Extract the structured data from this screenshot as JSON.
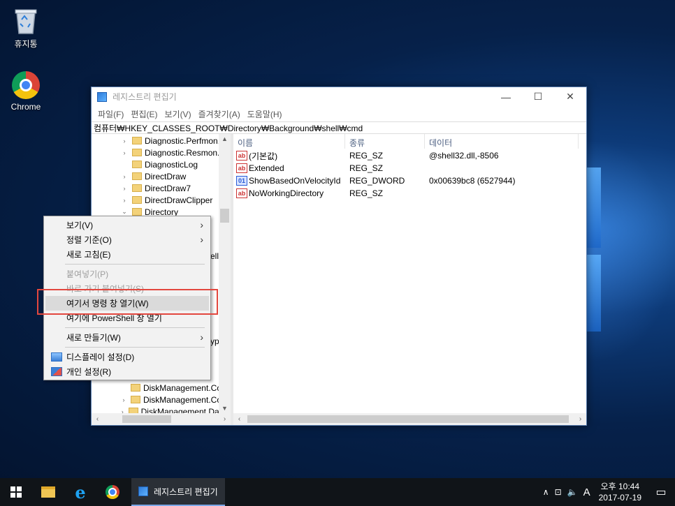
{
  "desktop": {
    "icons": [
      {
        "label": "휴지통",
        "icon": "recycle-bin-icon"
      },
      {
        "label": "Chrome",
        "icon": "chrome-icon"
      }
    ]
  },
  "window": {
    "title": "레지스트리 편집기",
    "menu": [
      "파일(F)",
      "편집(E)",
      "보기(V)",
      "즐겨찾기(A)",
      "도움말(H)"
    ],
    "address": "컴퓨터₩HKEY_CLASSES_ROOT₩Directory₩Background₩shell₩cmd",
    "tree": [
      {
        "label": "Diagnostic.Perfmon.D",
        "expander": "›"
      },
      {
        "label": "Diagnostic.Resmon.C",
        "expander": "›"
      },
      {
        "label": "DiagnosticLog",
        "expander": ""
      },
      {
        "label": "DirectDraw",
        "expander": "›"
      },
      {
        "label": "DirectDraw7",
        "expander": "›"
      },
      {
        "label": "DirectDrawClipper",
        "expander": "›"
      },
      {
        "label": "Directory",
        "expander": "⌄"
      }
    ],
    "tree_partial_labels": {
      "row_a": "ell",
      "row_b": "ypt"
    },
    "tree_bottom": [
      {
        "label": "DiskManagement.Co",
        "expander": ""
      },
      {
        "label": "DiskManagement.Co",
        "expander": "›"
      },
      {
        "label": "DiskManagement.Dat",
        "expander": "›"
      }
    ],
    "columns": {
      "name": "이름",
      "type": "종류",
      "data": "데이터"
    },
    "values": [
      {
        "name": "(기본값)",
        "type": "REG_SZ",
        "data": "@shell32.dll,-8506",
        "icon": "ab"
      },
      {
        "name": "Extended",
        "type": "REG_SZ",
        "data": "",
        "icon": "ab"
      },
      {
        "name": "ShowBasedOnVelocityId",
        "type": "REG_DWORD",
        "data": "0x00639bc8 (6527944)",
        "icon": "bin"
      },
      {
        "name": "NoWorkingDirectory",
        "type": "REG_SZ",
        "data": "",
        "icon": "ab"
      }
    ]
  },
  "context_menu": {
    "items": [
      {
        "label": "보기(V)",
        "submenu": true,
        "disabled": false
      },
      {
        "label": "정렬 기준(O)",
        "submenu": true,
        "disabled": false
      },
      {
        "label": "새로 고침(E)",
        "submenu": false,
        "disabled": false
      },
      {
        "label": "붙여넣기(P)",
        "submenu": false,
        "disabled": true
      },
      {
        "label": "바로 가기 붙여넣기(S)",
        "submenu": false,
        "disabled": true
      },
      {
        "label": "여기서 명령 창 열기(W)",
        "submenu": false,
        "disabled": false,
        "highlighted": true
      },
      {
        "label": "여기에 PowerShell 창 열기",
        "submenu": false,
        "disabled": false
      },
      {
        "label": "새로 만들기(W)",
        "submenu": true,
        "disabled": false
      },
      {
        "label": "디스플레이 설정(D)",
        "submenu": false,
        "disabled": false
      },
      {
        "label": "개인 설정(R)",
        "submenu": false,
        "disabled": false
      }
    ]
  },
  "taskbar": {
    "task_label": "레지스트리 편집기",
    "tray_ime": "A",
    "clock_time": "오후 10:44",
    "clock_date": "2017-07-19"
  },
  "colors": {
    "highlight_box": "#e3473e",
    "taskbar": "#101418"
  }
}
